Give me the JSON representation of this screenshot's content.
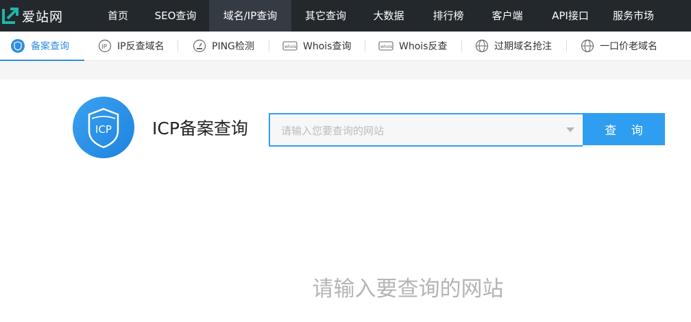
{
  "logo": {
    "text": "爱站网"
  },
  "topnav": {
    "items": [
      {
        "label": "首页"
      },
      {
        "label": "SEO查询"
      },
      {
        "label": "域名/IP查询"
      },
      {
        "label": "其它查询"
      },
      {
        "label": "大数据"
      },
      {
        "label": "排行榜"
      },
      {
        "label": "客户端"
      },
      {
        "label": "API接口"
      },
      {
        "label": "服务市场"
      }
    ],
    "active_index": 2
  },
  "subnav": {
    "items": [
      {
        "label": "备案查询",
        "icon": "icp-icon"
      },
      {
        "label": "IP反查域名",
        "icon": "ip-icon"
      },
      {
        "label": "PING检测",
        "icon": "gauge-icon"
      },
      {
        "label": "Whois查询",
        "icon": "whois-icon"
      },
      {
        "label": "Whois反查",
        "icon": "whois-icon"
      },
      {
        "label": "过期域名抢注",
        "icon": "globe-icon"
      },
      {
        "label": "一口价老域名",
        "icon": "globe-icon"
      }
    ],
    "active_index": 0
  },
  "hero": {
    "badge_text": "ICP",
    "title": "ICP备案查询",
    "search_placeholder": "请输入您要查询的网站",
    "search_value": "",
    "button_label": "查 询"
  },
  "hint": "请输入要查询的网站",
  "colors": {
    "topbar": "#23282d",
    "accent": "#2f9ef0",
    "active_sub": "#2f8ee0"
  }
}
